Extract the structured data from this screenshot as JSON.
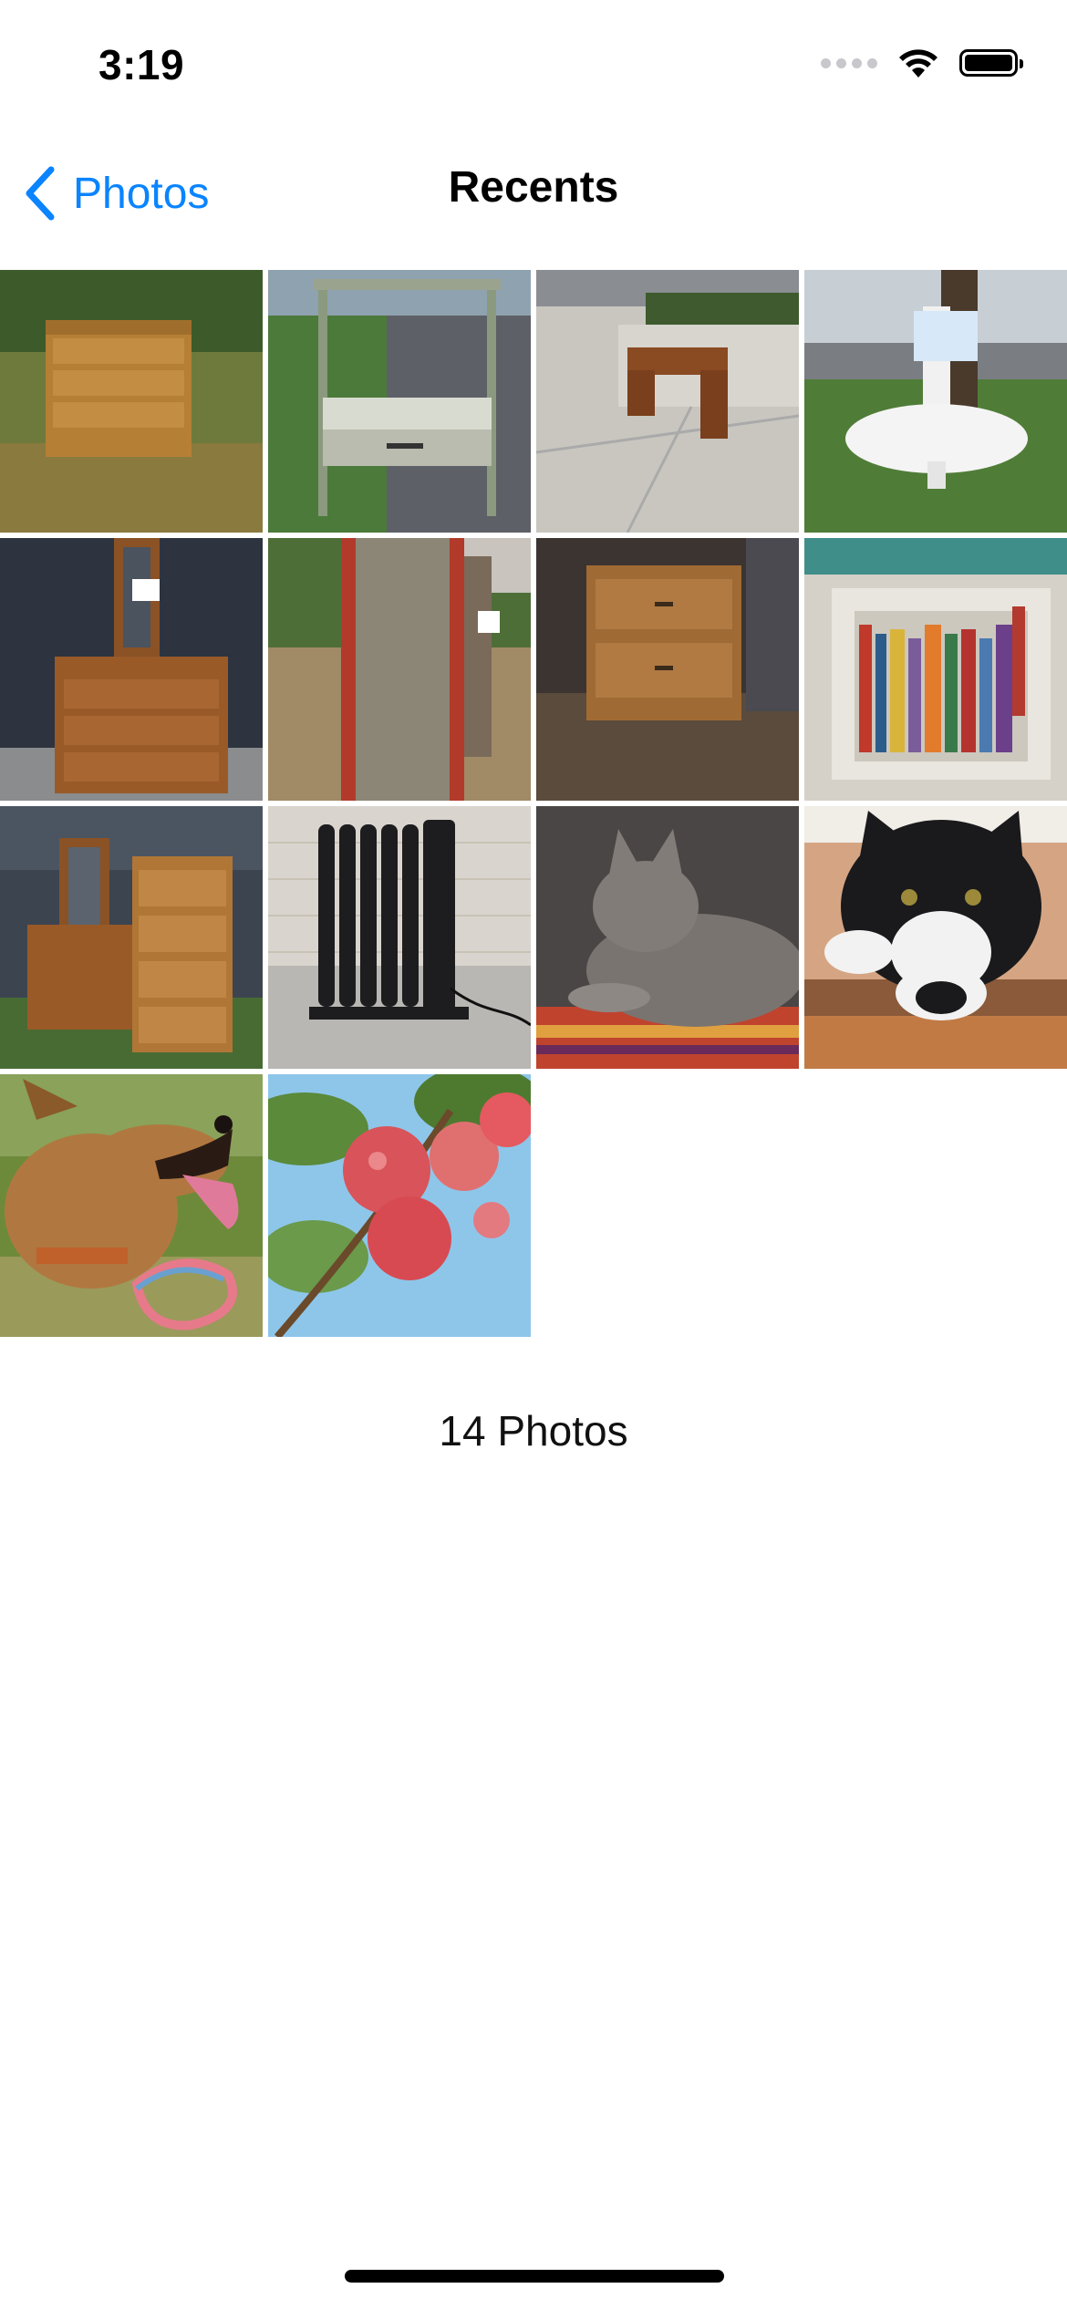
{
  "status_bar": {
    "time": "3:19",
    "icons": [
      "signal-icon",
      "wifi-icon",
      "battery-icon"
    ]
  },
  "nav": {
    "back_label": "Photos",
    "back_icon": "chevron-left-icon",
    "title": "Recents",
    "accent_color": "#0A84FF"
  },
  "photos": [
    {
      "subject": "wooden dresser on lawn"
    },
    {
      "subject": "nightstand by curb"
    },
    {
      "subject": "small desk on sidewalk"
    },
    {
      "subject": "sink with free sign"
    },
    {
      "subject": "dresser with mirror in garage"
    },
    {
      "subject": "red framed mirror against tree"
    },
    {
      "subject": "wooden nightstand"
    },
    {
      "subject": "little free library bookshelf"
    },
    {
      "subject": "dresser and tall chest"
    },
    {
      "subject": "oil radiator heater"
    },
    {
      "subject": "gray cat on rug"
    },
    {
      "subject": "black and white cat"
    },
    {
      "subject": "dog with rope toy"
    },
    {
      "subject": "apples on tree branch"
    }
  ],
  "count_label": "14 Photos"
}
